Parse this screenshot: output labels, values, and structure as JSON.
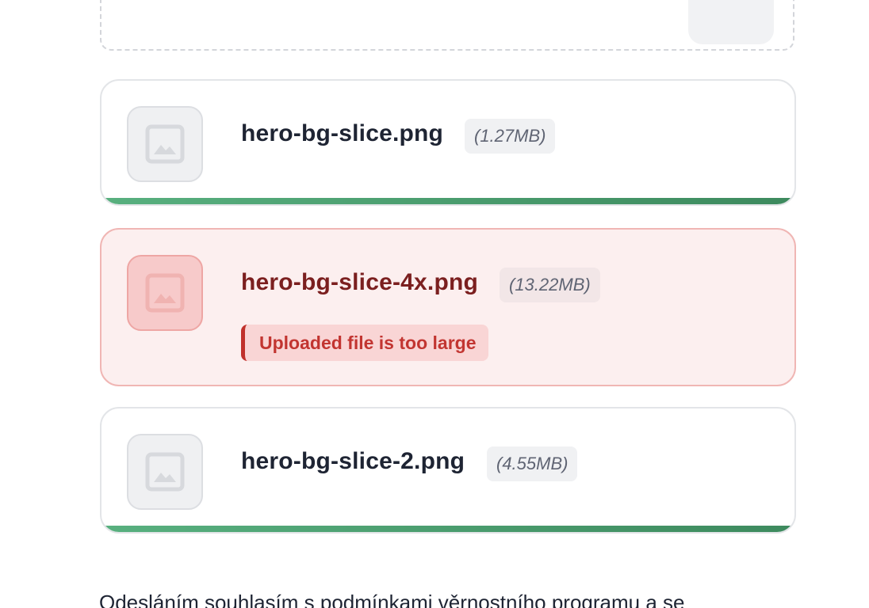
{
  "files": [
    {
      "name": "hero-bg-slice.png",
      "size": "(1.27MB)",
      "status": "uploaded",
      "progress": 1.0,
      "icon": "image-icon"
    },
    {
      "name": "hero-bg-slice-4x.png",
      "size": "(13.22MB)",
      "status": "error",
      "error": "Uploaded file is too large",
      "icon": "image-icon"
    },
    {
      "name": "hero-bg-slice-2.png",
      "size": "(4.55MB)",
      "status": "uploaded",
      "progress": 1.0,
      "icon": "image-icon"
    }
  ],
  "consent_text": "Odesláním souhlasím s podmínkami věrnostního programu a se",
  "colors": {
    "success": "#4f9f72",
    "error_text": "#c23531",
    "error_bg": "#fcefef",
    "error_border": "#f0b6b4"
  }
}
